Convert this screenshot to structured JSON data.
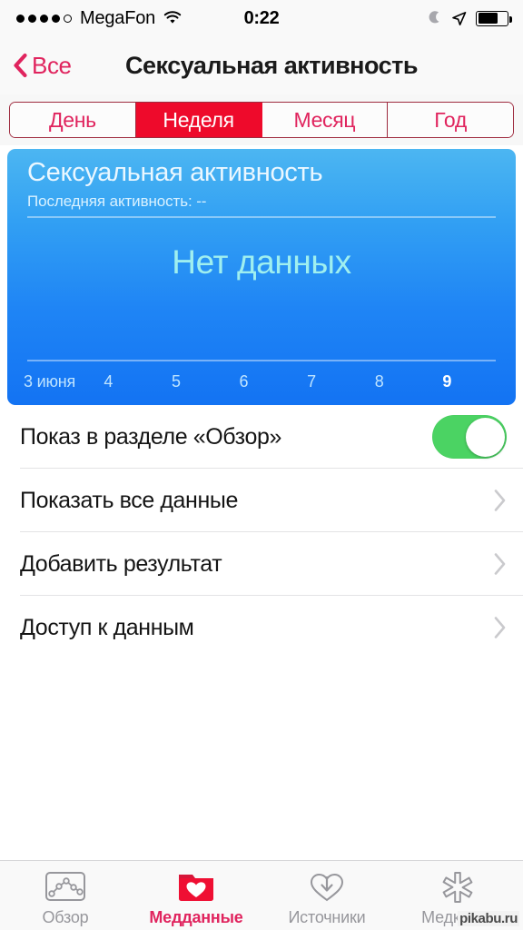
{
  "status_bar": {
    "signal_dots_filled": 4,
    "signal_dots_total": 5,
    "carrier": "MegaFon",
    "wifi_icon": "wifi-icon",
    "time": "0:22",
    "moon_icon": "moon-icon",
    "location_icon": "location-arrow-icon",
    "battery_icon": "battery-icon",
    "battery_level_percent": 62
  },
  "nav_bar": {
    "back_icon": "chevron-left-icon",
    "back_label": "Все",
    "title": "Сексуальная активность",
    "accent_color": "#e0245e"
  },
  "segmented_control": {
    "selected_index": 1,
    "selected_color": "#ee0a2b",
    "border_color": "#9e2b3f",
    "items": [
      {
        "label": "День"
      },
      {
        "label": "Неделя"
      },
      {
        "label": "Месяц"
      },
      {
        "label": "Год"
      }
    ]
  },
  "chart_card": {
    "title": "Сексуальная активность",
    "subtitle": "Последняя активность: --",
    "empty_message": "Нет данных",
    "gradient_top": "#4cb6f2",
    "gradient_bottom": "#1373f3"
  },
  "chart_data": {
    "type": "bar",
    "title": "Сексуальная активность",
    "subtitle": "Последняя активность: --",
    "empty_state": "Нет данных",
    "xlabel": "",
    "ylabel": "",
    "grid": false,
    "legend": false,
    "period": "Неделя",
    "categories": [
      "3 июня",
      "4",
      "5",
      "6",
      "7",
      "8",
      "9"
    ],
    "values": [
      0,
      0,
      0,
      0,
      0,
      0,
      0
    ],
    "ylim": [
      0,
      0
    ],
    "highlighted_category": "9",
    "annotations": [
      "Нет данных"
    ]
  },
  "settings_list": {
    "toggle_row": {
      "label": "Показ в разделе «Обзор»",
      "toggle_state": "on",
      "toggle_on_color": "#4bd363"
    },
    "rows": [
      {
        "label": "Показать все данные",
        "chevron": "chevron-right-icon"
      },
      {
        "label": "Добавить результат",
        "chevron": "chevron-right-icon"
      },
      {
        "label": "Доступ к данным",
        "chevron": "chevron-right-icon"
      }
    ]
  },
  "tab_bar": {
    "active_index": 1,
    "active_color": "#e0245e",
    "inactive_color": "#97979c",
    "tabs": [
      {
        "label": "Обзор",
        "icon": "line-chart-card-icon"
      },
      {
        "label": "Медданные",
        "icon": "folder-heart-icon"
      },
      {
        "label": "Источники",
        "icon": "heart-download-icon"
      },
      {
        "label": "Медкарта",
        "icon": "medical-asterisk-icon"
      }
    ]
  },
  "watermark": {
    "text": "pikabu.ru"
  }
}
